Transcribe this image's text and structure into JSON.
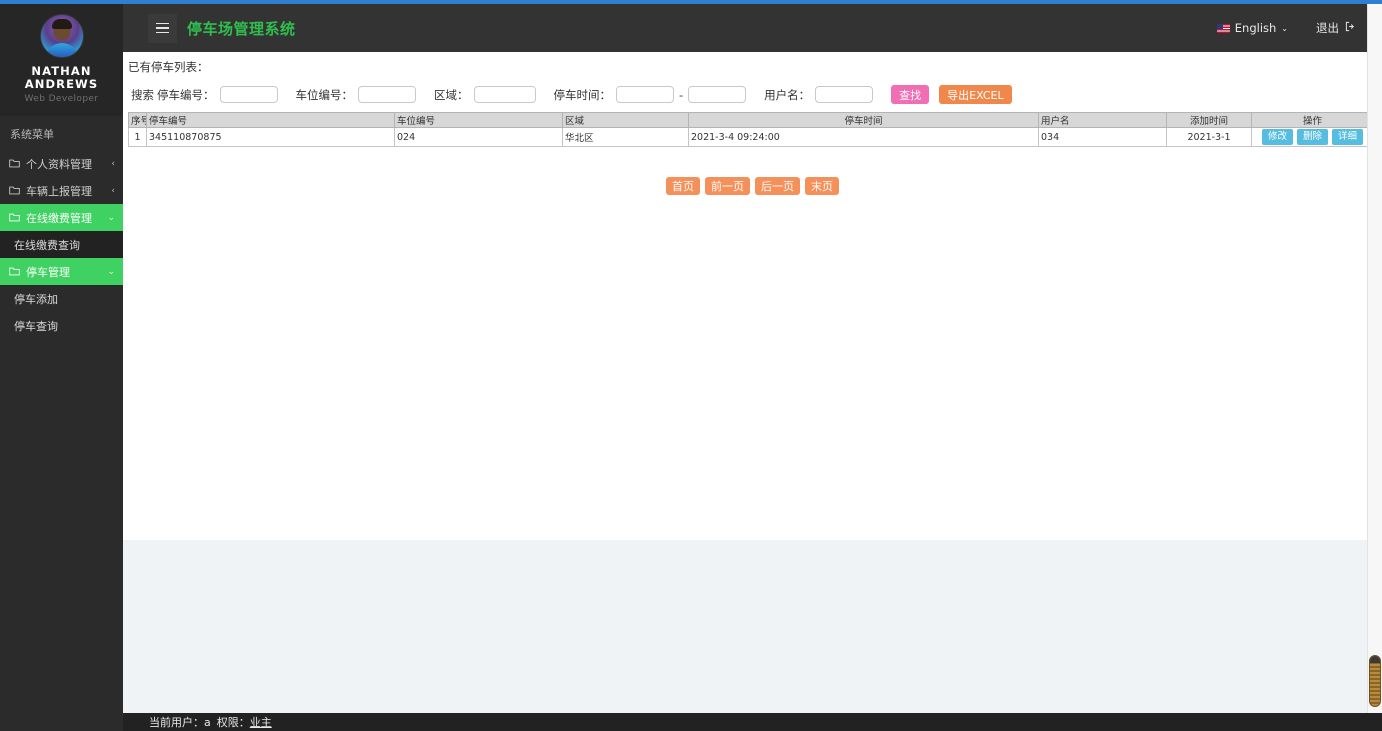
{
  "sidebar": {
    "brand": {
      "name_line1": "NATHAN",
      "name_line2": "ANDREWS",
      "role": "Web Developer"
    },
    "menu_title": "系统菜单",
    "items": [
      {
        "label": "个人资料管理",
        "caret": "‹",
        "active": false
      },
      {
        "label": "车辆上报管理",
        "caret": "‹",
        "active": false
      },
      {
        "label": "在线缴费管理",
        "caret": "⌄",
        "active": true
      },
      {
        "label": "在线缴费查询",
        "sub": true
      },
      {
        "label": "停车管理",
        "caret": "⌄",
        "active": true
      },
      {
        "label": "停车添加",
        "sub": true
      },
      {
        "label": "停车查询",
        "sub": true
      }
    ]
  },
  "header": {
    "title": "停车场管理系统",
    "language": "English",
    "language_caret": "⌄",
    "logout": "退出"
  },
  "main": {
    "breadcrumb": "已有停车列表：",
    "search": {
      "lead": "搜索",
      "fields": [
        {
          "label": "停车编号：",
          "value": "",
          "placeholder": ""
        },
        {
          "label": "车位编号：",
          "value": "",
          "placeholder": ""
        },
        {
          "label": "区域：",
          "value": "",
          "placeholder": ""
        },
        {
          "label": "停车时间：",
          "value": "",
          "placeholder": ""
        }
      ],
      "range_separator": "-",
      "time_to_value": "",
      "username_label": "用户名：",
      "username_value": "",
      "find_button": "查找",
      "export_button": "导出EXCEL"
    },
    "table": {
      "columns": [
        "序号",
        "停车编号",
        "车位编号",
        "区域",
        "停车时间",
        "用户名",
        "添加时间",
        "操作"
      ],
      "rows": [
        {
          "index": "1",
          "parking_no": "345110870875",
          "space_no": "024",
          "region": "华北区",
          "park_time": "2021-3-4 09:24:00",
          "username": "034",
          "add_time": "2021-3-1",
          "actions": [
            "修改",
            "删除",
            "详细"
          ]
        }
      ]
    },
    "pagination": [
      "首页",
      "前一页",
      "后一页",
      "末页"
    ]
  },
  "footer": {
    "user_label": "当前用户：",
    "user_value": "a",
    "role_label": "权限：",
    "role_value": "业主"
  },
  "colors": {
    "accent_green": "#3fd162",
    "title_green": "#2fbf4f",
    "find_pink": "#f06eb4",
    "export_orange": "#f0884c",
    "action_blue": "#56bde0",
    "pager_orange": "#f4905a",
    "sidebar_dark": "#2b2b2b",
    "header_dark": "#333333"
  }
}
